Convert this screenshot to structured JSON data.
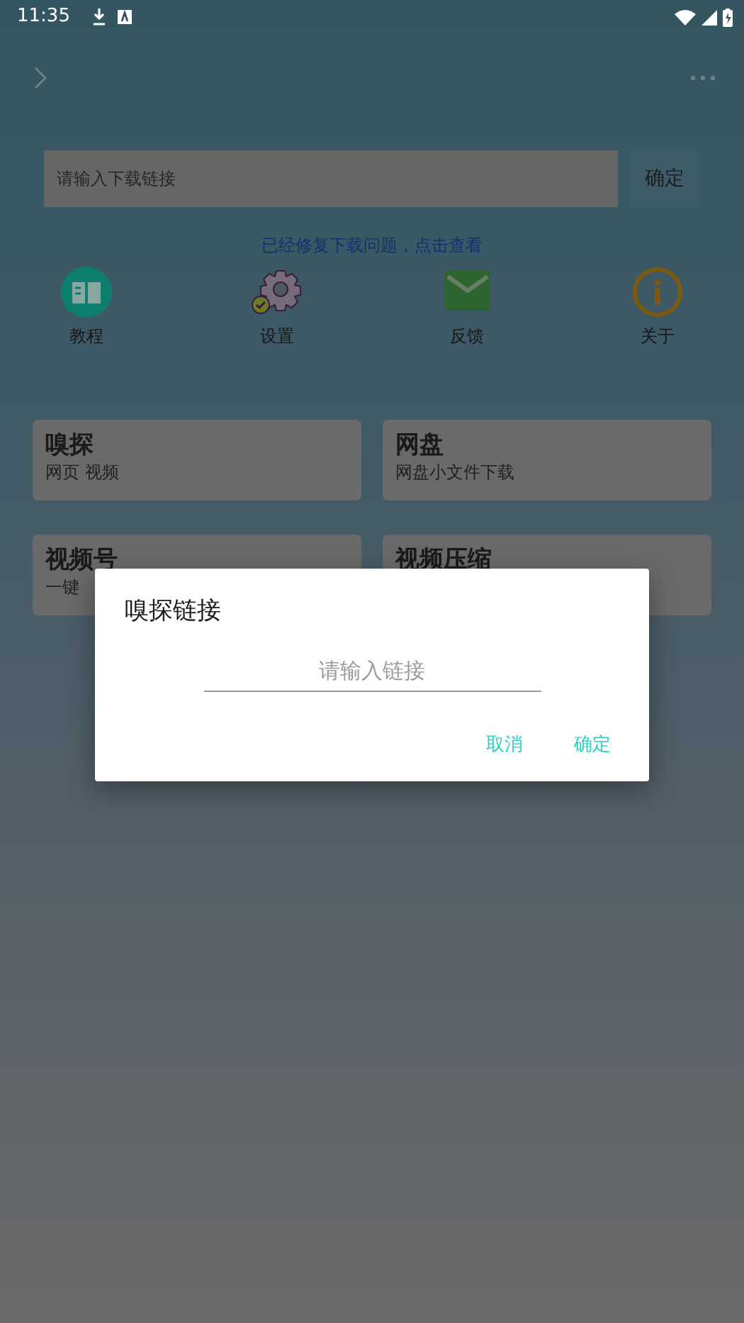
{
  "status_bar": {
    "time": "11:35"
  },
  "search": {
    "placeholder": "请输入下载链接",
    "button": "确定"
  },
  "notice": "已经修复下载问题，点击查看",
  "shortcuts": [
    {
      "kind": "book",
      "label": "教程"
    },
    {
      "kind": "gear",
      "label": "设置"
    },
    {
      "kind": "mail",
      "label": "反馈"
    },
    {
      "kind": "info",
      "label": "关于"
    }
  ],
  "cards": [
    {
      "title": "嗅探",
      "subtitle": "网页 视频"
    },
    {
      "title": "网盘",
      "subtitle": "网盘小文件下载"
    },
    {
      "title": "视频号",
      "subtitle": "一键"
    },
    {
      "title": "视频压缩"
    }
  ],
  "dialog": {
    "title": "嗅探链接",
    "placeholder": "请输入链接",
    "buttons": [
      "取消",
      "确定"
    ]
  }
}
